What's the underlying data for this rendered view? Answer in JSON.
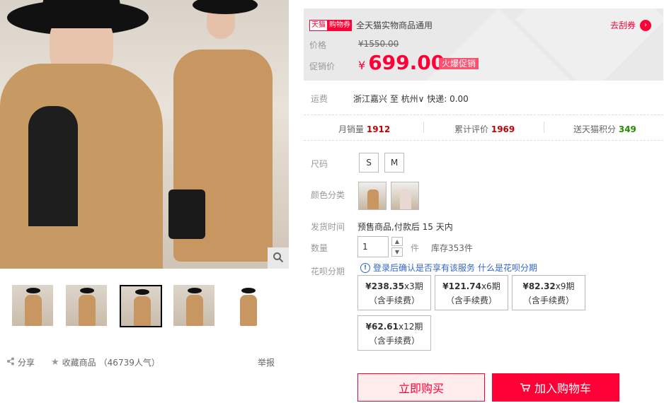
{
  "gallery": {
    "zoom_icon": "magnifier-icon",
    "thumbnails": [
      "thumb-1",
      "thumb-2",
      "thumb-3",
      "thumb-4",
      "thumb-5"
    ],
    "selected_thumbnail_index": 2
  },
  "actions": {
    "share_label": "分享",
    "favorite_label": "收藏商品",
    "favorite_count": "（46739人气）",
    "report_label": "举报"
  },
  "coupon": {
    "tmall_tag": "天猫",
    "coupon_tag": "购物券",
    "text": "全天猫实物商品通用",
    "get_label": "去刮券"
  },
  "price": {
    "price_label": "价格",
    "original": "¥1550.00",
    "promo_label": "促销价",
    "currency": "¥",
    "promo": "699.00",
    "hot_tag": "火爆促销"
  },
  "shipping": {
    "label": "运费",
    "text": "浙江嘉兴 至 杭州∨ 快递: 0.00"
  },
  "stats": {
    "monthly_sales_label": "月销量",
    "monthly_sales": "1912",
    "reviews_label": "累计评价",
    "reviews": "1969",
    "points_label": "送天猫积分",
    "points": "349"
  },
  "size": {
    "label": "尺码",
    "options": [
      "S",
      "M"
    ]
  },
  "color": {
    "label": "颜色分类"
  },
  "ship_time": {
    "label": "发货时间",
    "value": "预售商品,付款后 15 天内"
  },
  "quantity": {
    "label": "数量",
    "value": "1",
    "unit": "件",
    "stock": "库存353件"
  },
  "huabei": {
    "label": "花呗分期",
    "info": "登录后确认是否享有该服务",
    "link": "什么是花呗分期",
    "plans": [
      {
        "amount": "¥238.35",
        "periods": "x3期",
        "fee": "（含手续费）"
      },
      {
        "amount": "¥121.74",
        "periods": "x6期",
        "fee": "（含手续费）"
      },
      {
        "amount": "¥82.32",
        "periods": "x9期",
        "fee": "（含手续费）"
      },
      {
        "amount": "¥62.61",
        "periods": "x12期",
        "fee": "（含手续费）"
      }
    ]
  },
  "buttons": {
    "buy_now": "立即购买",
    "add_cart": "加入购物车"
  },
  "colors": {
    "accent": "#ff0036",
    "stat_red": "#c40000",
    "stat_green": "#258c00",
    "link_blue": "#3366cc"
  }
}
